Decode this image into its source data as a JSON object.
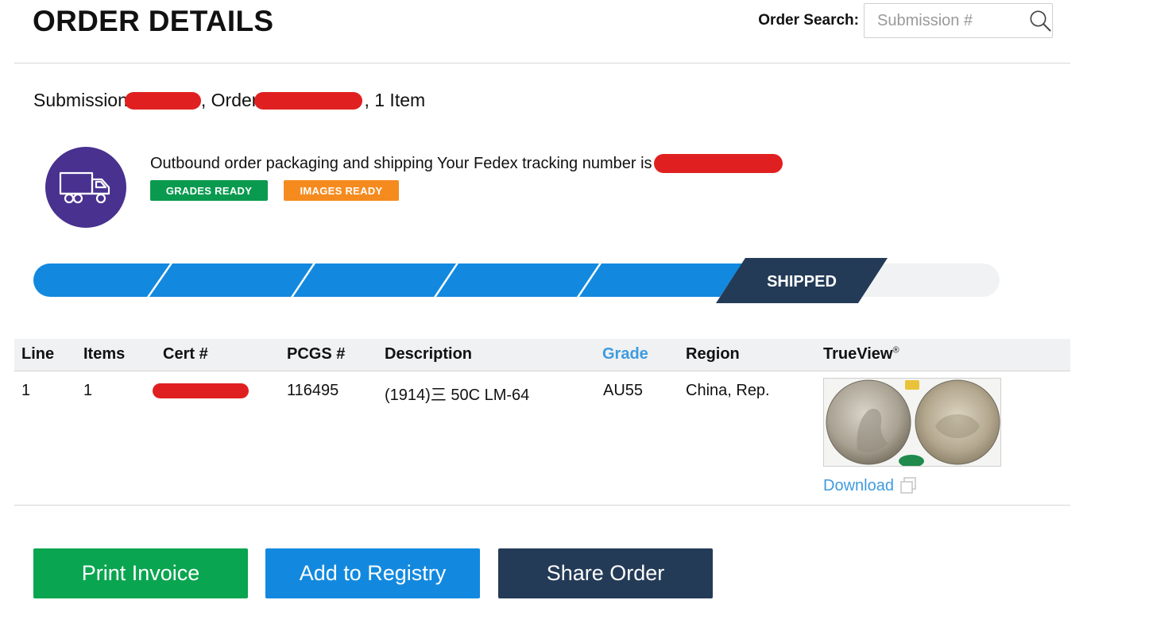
{
  "header": {
    "title": "ORDER DETAILS",
    "search_label": "Order Search:",
    "search_placeholder": "Submission #"
  },
  "summary": {
    "submission_label": "Submission",
    "order_label": ", Order",
    "items_text": ", 1 Item"
  },
  "status": {
    "message": "Outbound order packaging and shipping Your Fedex tracking number is",
    "badges": [
      "GRADES READY",
      "IMAGES READY"
    ],
    "current_stage": "SHIPPED",
    "completed_stages": 5
  },
  "table": {
    "columns": [
      "Line",
      "Items",
      "Cert #",
      "PCGS #",
      "Description",
      "Grade",
      "Region",
      "TrueView"
    ],
    "trueview_mark": "®",
    "rows": [
      {
        "line": "1",
        "items": "1",
        "pcgs": "116495",
        "description": "(1914)三 50C LM-64",
        "grade": "AU55",
        "region": "China, Rep.",
        "download": "Download"
      }
    ]
  },
  "actions": {
    "print": "Print Invoice",
    "registry": "Add to Registry",
    "share": "Share Order"
  },
  "colors": {
    "progress_blue": "#1289df",
    "shipped_navy": "#243b57",
    "truck_purple": "#48318f",
    "grades_green": "#0a9a4f",
    "images_orange": "#f58b1f",
    "redaction_red": "#e02020",
    "link_blue": "#3e9be0"
  },
  "icons": [
    "search-icon",
    "truck-icon",
    "copy-icon"
  ]
}
